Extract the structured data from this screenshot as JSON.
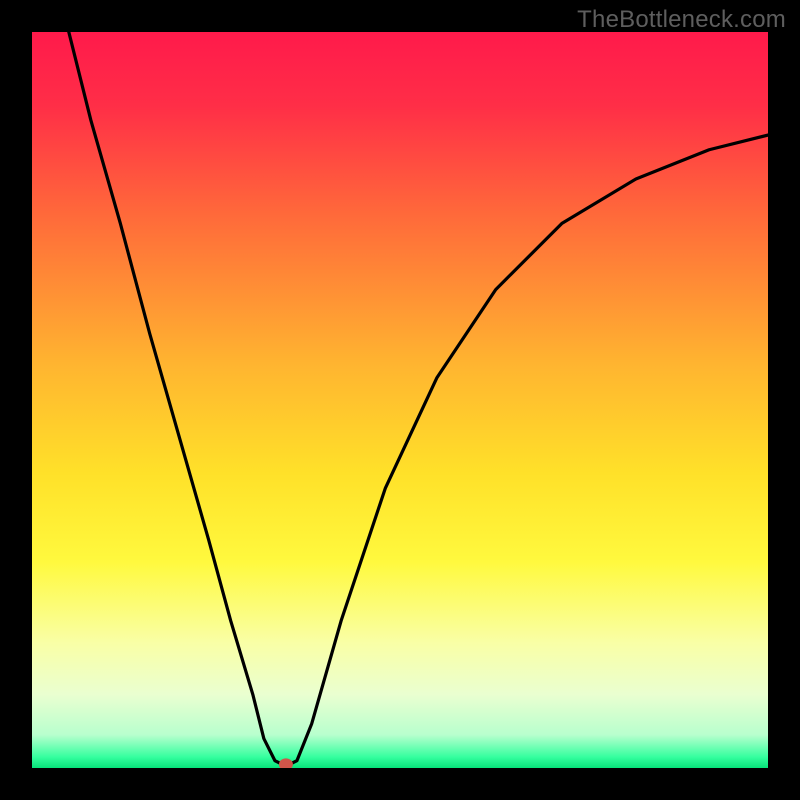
{
  "watermark": "TheBottleneck.com",
  "chart_data": {
    "type": "line",
    "title": "",
    "xlabel": "",
    "ylabel": "",
    "xlim": [
      0,
      100
    ],
    "ylim": [
      0,
      100
    ],
    "background_gradient": [
      {
        "pos": 0.0,
        "color": "#ff1a4b"
      },
      {
        "pos": 0.1,
        "color": "#ff2e47"
      },
      {
        "pos": 0.25,
        "color": "#ff6a3a"
      },
      {
        "pos": 0.45,
        "color": "#ffb430"
      },
      {
        "pos": 0.6,
        "color": "#ffe129"
      },
      {
        "pos": 0.72,
        "color": "#fff93e"
      },
      {
        "pos": 0.83,
        "color": "#f9ffa6"
      },
      {
        "pos": 0.9,
        "color": "#eaffd0"
      },
      {
        "pos": 0.955,
        "color": "#b8ffce"
      },
      {
        "pos": 0.985,
        "color": "#35ff9f"
      },
      {
        "pos": 1.0,
        "color": "#07e37a"
      }
    ],
    "series": [
      {
        "name": "bottleneck-curve",
        "x": [
          5,
          8,
          12,
          16,
          20,
          24,
          27,
          30,
          31.5,
          33,
          34,
          35,
          36,
          38,
          42,
          48,
          55,
          63,
          72,
          82,
          92,
          100
        ],
        "y": [
          100,
          88,
          74,
          59,
          45,
          31,
          20,
          10,
          4,
          1,
          0.5,
          0.5,
          1,
          6,
          20,
          38,
          53,
          65,
          74,
          80,
          84,
          86
        ]
      }
    ],
    "marker": {
      "x": 34.5,
      "y": 0.5,
      "color": "#cf554a"
    }
  }
}
